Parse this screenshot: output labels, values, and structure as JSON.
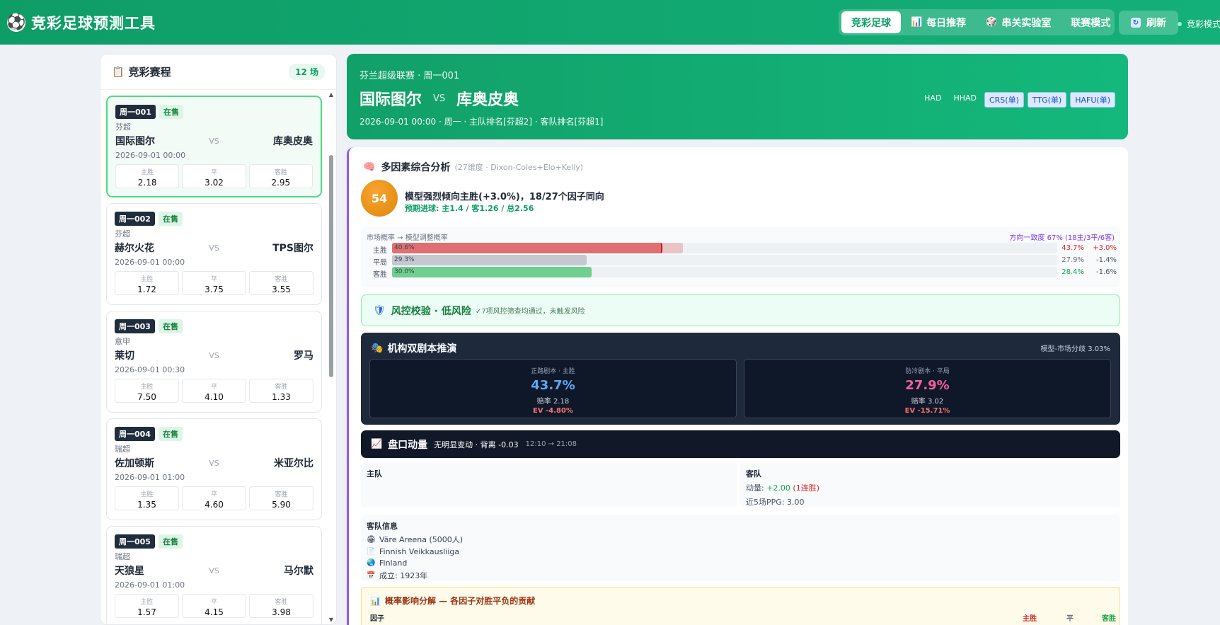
{
  "app": {
    "title": "竞彩足球预测工具",
    "logo_icon": "soccer-ball-icon"
  },
  "nav": {
    "tabs": [
      {
        "label": "竞彩足球",
        "icon": "",
        "active": true
      },
      {
        "label": "每日推荐",
        "icon": "bar-chart-icon",
        "active": false
      },
      {
        "label": "串关实验室",
        "icon": "dice-icon",
        "active": false
      },
      {
        "label": "联赛模式",
        "icon": "",
        "active": false
      }
    ],
    "refresh_label": "刷新",
    "mode_label": "竞彩模式"
  },
  "sidebar": {
    "title": "竞彩赛程",
    "count": "12 场",
    "matches": [
      {
        "code": "周一001",
        "status": "在售",
        "league": "芬超",
        "home": "国际图尔",
        "vs": "VS",
        "away": "库奥皮奥",
        "time": "2026-09-01 00:00",
        "odds": [
          {
            "label": "主胜",
            "value": "2.18"
          },
          {
            "label": "平",
            "value": "3.02"
          },
          {
            "label": "客胜",
            "value": "2.95"
          }
        ],
        "selected": true
      },
      {
        "code": "周一002",
        "status": "在售",
        "league": "芬超",
        "home": "赫尔火花",
        "vs": "VS",
        "away": "TPS图尔",
        "time": "2026-09-01 00:00",
        "odds": [
          {
            "label": "主胜",
            "value": "1.72"
          },
          {
            "label": "平",
            "value": "3.75"
          },
          {
            "label": "客胜",
            "value": "3.55"
          }
        ]
      },
      {
        "code": "周一003",
        "status": "在售",
        "league": "意甲",
        "home": "莱切",
        "vs": "VS",
        "away": "罗马",
        "time": "2026-09-01 00:30",
        "odds": [
          {
            "label": "主胜",
            "value": "7.50"
          },
          {
            "label": "平",
            "value": "4.10"
          },
          {
            "label": "客胜",
            "value": "1.33"
          }
        ]
      },
      {
        "code": "周一004",
        "status": "在售",
        "league": "瑞超",
        "home": "佐加顿斯",
        "vs": "VS",
        "away": "米亚尔比",
        "time": "2026-09-01 01:00",
        "odds": [
          {
            "label": "主胜",
            "value": "1.35"
          },
          {
            "label": "平",
            "value": "4.60"
          },
          {
            "label": "客胜",
            "value": "5.90"
          }
        ]
      },
      {
        "code": "周一005",
        "status": "在售",
        "league": "瑞超",
        "home": "天狼星",
        "vs": "VS",
        "away": "马尔默",
        "time": "2026-09-01 01:00",
        "odds": [
          {
            "label": "主胜",
            "value": "1.57"
          },
          {
            "label": "平",
            "value": "4.15"
          },
          {
            "label": "客胜",
            "value": "3.98"
          }
        ]
      }
    ]
  },
  "hero": {
    "league_line": "芬兰超级联赛 · 周一001",
    "home": "国际图尔",
    "vs": "VS",
    "away": "库奥皮奥",
    "info": "2026-09-01 00:00 · 周一 · 主队排名[芬超2] · 客队排名[芬超1]",
    "markets": [
      {
        "label": "HAD",
        "selected": false
      },
      {
        "label": "HHAD",
        "selected": false
      },
      {
        "label": "CRS(单)",
        "selected": true
      },
      {
        "label": "TTG(单)",
        "selected": true
      },
      {
        "label": "HAFU(单)",
        "selected": true
      }
    ]
  },
  "analysis": {
    "title": "多因素综合分析",
    "subtitle": "(27维度 · Dixon-Coles+Elo+Kelly)",
    "score": "54",
    "verdict": "模型强烈倾向主胜(+3.0%)，18/27个因子同向",
    "expected": "预期进球: 主1.4 / 客1.26 / 总2.56",
    "prob_header": "市场概率 → 模型调整概率",
    "consistency": "方向一致度 67% (18主/3平/6客)",
    "rows": [
      {
        "label": "主胜",
        "market": 40.6,
        "market_text": "40.6%",
        "model": 43.7,
        "model_text": "43.7%",
        "delta": "+3.0%",
        "color": "#e07070",
        "delta_color": "#dc2626"
      },
      {
        "label": "平局",
        "market": 29.3,
        "market_text": "29.3%",
        "model": 27.9,
        "model_text": "27.9%",
        "delta": "-1.4%",
        "color": "#c4c8cf",
        "delta_color": "#4b5563"
      },
      {
        "label": "客胜",
        "market": 30.0,
        "market_text": "30.0%",
        "model": 28.4,
        "model_text": "28.4%",
        "delta": "-1.6%",
        "color": "#6fcf8f",
        "delta_color": "#4b5563"
      }
    ]
  },
  "risk": {
    "title": "风控校验 · 低风险",
    "detail": "✓7项风控筛查均通过，未触发风险"
  },
  "scenario": {
    "title": "机构双剧本推演",
    "gap": "模型-市场分歧 3.03%",
    "boxes": [
      {
        "head": "正路剧本 · 主胜",
        "prob": "43.7%",
        "odds": "赔率 2.18",
        "ev": "EV -4.80%",
        "color": "#5aa9f5"
      },
      {
        "head": "防冷剧本 · 平局",
        "prob": "27.9%",
        "odds": "赔率 3.02",
        "ev": "EV -15.71%",
        "color": "#f4609f"
      }
    ]
  },
  "momentum": {
    "title": "盘口动量",
    "summary": "无明显变动 · 背离 -0.03",
    "time": "12:10 → 21:08",
    "home_title": "主队",
    "away_title": "客队",
    "away_momentum_label": "动量: ",
    "away_momentum_value": "+2.00",
    "away_momentum_note": "(1连胜)",
    "away_ppg": "近5场PPG: 3.00"
  },
  "away_info": {
    "title": "客队信息",
    "items": [
      {
        "icon": "stadium-icon",
        "glyph": "🏟",
        "text": "Väre Areena (5000人)"
      },
      {
        "icon": "document-icon",
        "glyph": "📄",
        "text": "Finnish Veikkausliiga"
      },
      {
        "icon": "globe-icon",
        "glyph": "🌏",
        "text": "Finland"
      },
      {
        "icon": "calendar-icon",
        "glyph": "📅",
        "text": "成立: 1923年"
      }
    ]
  },
  "decomposition": {
    "title": "概率影响分解 — 各因子对胜平负的贡献",
    "factor_col": "因子",
    "cols": [
      {
        "label": "主胜",
        "color": "#dc2626"
      },
      {
        "label": "平",
        "color": "#6b7280"
      },
      {
        "label": "客胜",
        "color": "#16a34a"
      }
    ]
  }
}
